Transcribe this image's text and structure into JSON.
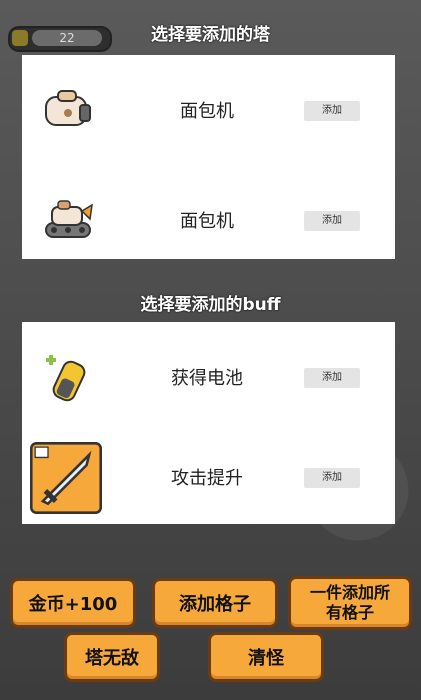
{
  "hud": {
    "level_text": "22"
  },
  "tower_section": {
    "title": "选择要添加的塔",
    "items": [
      {
        "name": "面包机",
        "add": "添加",
        "icon": "toaster-icon"
      },
      {
        "name": "面包机",
        "add": "添加",
        "icon": "toaster-tank-icon"
      }
    ]
  },
  "buff_section": {
    "title": "选择要添加的buff",
    "items": [
      {
        "name": "获得电池",
        "add": "添加",
        "icon": "battery-icon"
      },
      {
        "name": "攻击提升",
        "add": "添加",
        "icon": "sword-attack-icon"
      }
    ]
  },
  "actions": {
    "gold": "金币+100",
    "add_slot": "添加格子",
    "add_all_slots_line1": "一件添加所",
    "add_all_slots_line2": "有格子",
    "invincible": "塔无敌",
    "clear_monsters": "清怪"
  }
}
